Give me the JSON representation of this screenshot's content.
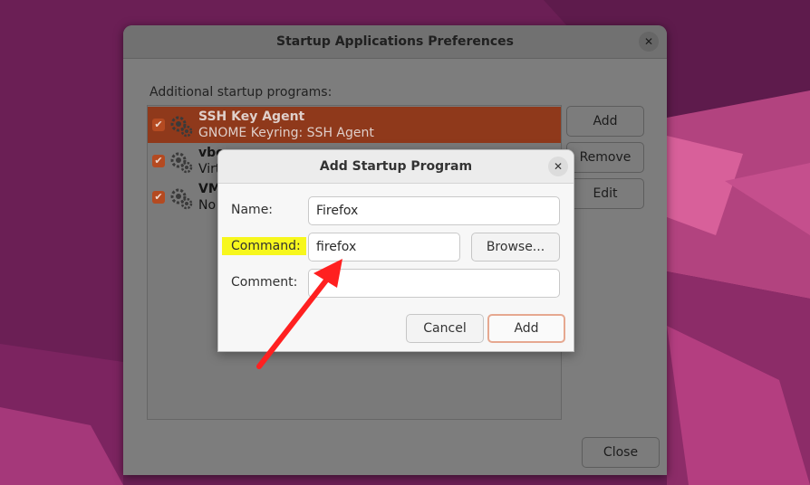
{
  "main_window": {
    "title": "Startup Applications Preferences",
    "close_icon": "✕",
    "section_label": "Additional startup programs:",
    "programs": [
      {
        "name": "SSH Key Agent",
        "description": "GNOME Keyring: SSH Agent",
        "checked": true,
        "selected": true
      },
      {
        "name": "vboxc",
        "description": "Virt",
        "checked": true,
        "selected": false
      },
      {
        "name": "VM",
        "description": "No",
        "checked": true,
        "selected": false
      }
    ],
    "checkmark": "✔",
    "add_label": "Add",
    "remove_label": "Remove",
    "edit_label": "Edit",
    "close_label": "Close"
  },
  "dialog": {
    "title": "Add Startup Program",
    "close_icon": "✕",
    "name_label": "Name:",
    "name_value": "Firefox",
    "command_label": "Command:",
    "command_value": "firefox",
    "browse_label": "Browse...",
    "comment_label": "Comment:",
    "comment_value": "",
    "cancel_label": "Cancel",
    "add_label": "Add"
  },
  "colors": {
    "selection": "#8f391b",
    "checkbox": "#b44a21",
    "highlight": "#f7f71d",
    "annotation_arrow": "#ff2020",
    "primary_button_border": "#e6a890"
  },
  "icons": {
    "program_icon": "gears-icon",
    "annotation": "red-arrow-annotation"
  }
}
